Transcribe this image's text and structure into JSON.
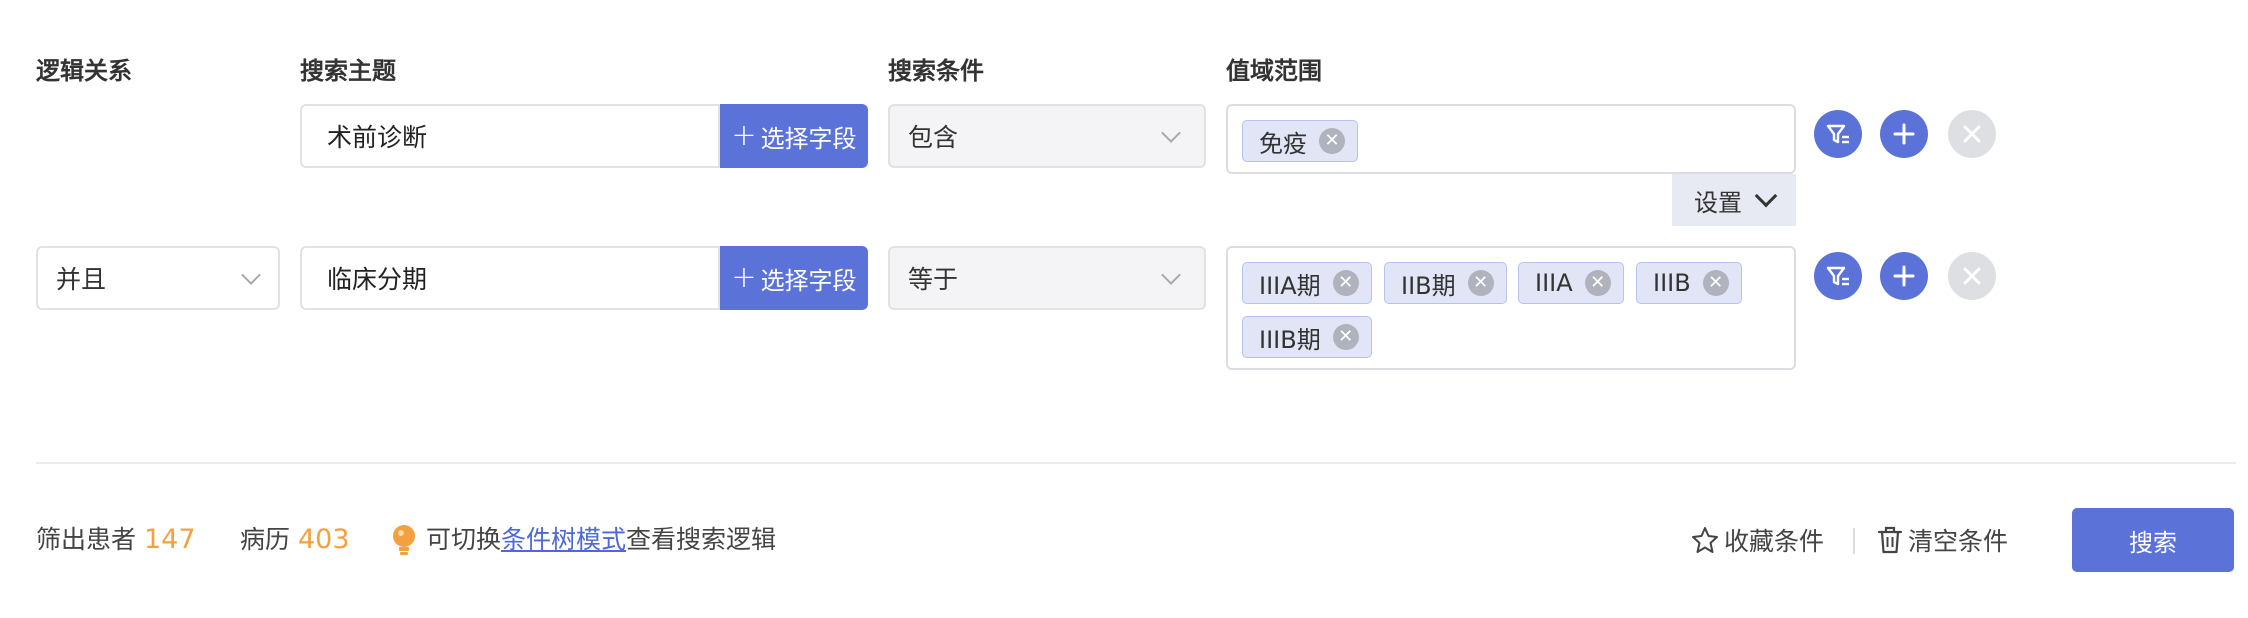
{
  "headers": {
    "logic": "逻辑关系",
    "subject": "搜索主题",
    "condition": "搜索条件",
    "range": "值域范围"
  },
  "rows": [
    {
      "logic": "",
      "subject": "术前诊断",
      "pick_label": "选择字段",
      "condition": "包含",
      "tags": [
        "免疫"
      ],
      "settings_label": "设置"
    },
    {
      "logic": "并且",
      "subject": "临床分期",
      "pick_label": "选择字段",
      "condition": "等于",
      "tags": [
        "IIIA期",
        "IIB期",
        "IIIA",
        "IIIB",
        "IIIB期"
      ]
    }
  ],
  "footer": {
    "patients_label": "筛出患者",
    "patients_count": "147",
    "records_label": "病历",
    "records_count": "403",
    "tip_prefix": "可切换",
    "tip_link": "条件树模式",
    "tip_suffix": "查看搜索逻辑",
    "favorite_label": "收藏条件",
    "clear_label": "清空条件",
    "search_label": "搜索"
  },
  "icons": {
    "plus": "plus-icon",
    "close": "close-icon",
    "filter": "filter-icon",
    "dropdown": "chevron-down-icon",
    "bulb": "lightbulb-icon",
    "star": "star-icon",
    "trash": "trash-icon"
  },
  "colors": {
    "primary": "#5b73d9",
    "count": "#f3a03f",
    "tag_bg": "#e1e5f6",
    "disabled": "#dedfe3"
  }
}
